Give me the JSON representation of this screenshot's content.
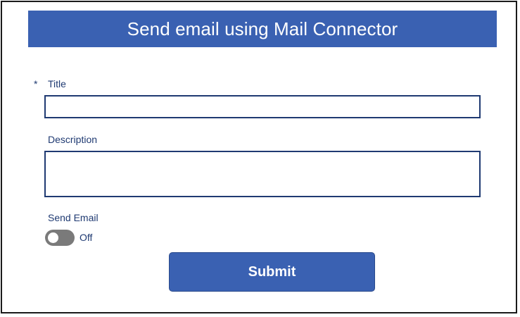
{
  "header": {
    "title": "Send email using Mail Connector"
  },
  "form": {
    "title_field": {
      "required_marker": "*",
      "label": "Title",
      "value": ""
    },
    "description_field": {
      "label": "Description",
      "value": ""
    },
    "send_email_field": {
      "label": "Send Email",
      "state_text": "Off",
      "checked": false
    },
    "submit_label": "Submit"
  },
  "colors": {
    "accent": "#3a61b2",
    "label_text": "#1f3a72",
    "toggle_off": "#7a7a7a"
  }
}
